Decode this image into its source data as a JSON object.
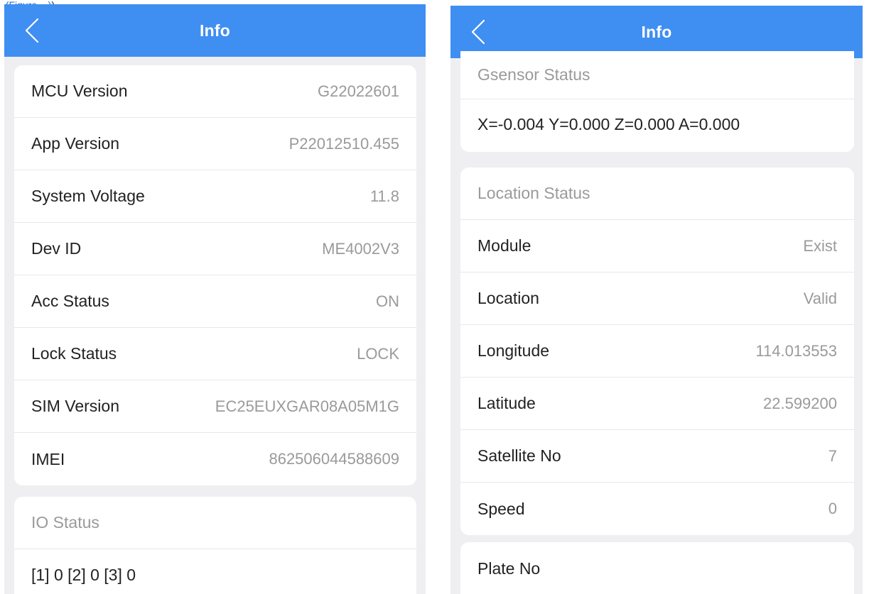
{
  "caption": {
    "prefix": ", ",
    "link": "(Figure ...)",
    "suffix": ")"
  },
  "left_screen": {
    "header": {
      "title": "Info",
      "back_icon": "chevron-left-icon"
    },
    "info_rows": [
      {
        "label": "MCU Version",
        "value": "G22022601"
      },
      {
        "label": "App Version",
        "value": "P22012510.455"
      },
      {
        "label": "System Voltage",
        "value": "11.8"
      },
      {
        "label": "Dev ID",
        "value": "ME4002V3"
      },
      {
        "label": "Acc Status",
        "value": "ON"
      },
      {
        "label": "Lock Status",
        "value": "LOCK"
      },
      {
        "label": "SIM Version",
        "value": "EC25EUXGAR08A05M1G"
      },
      {
        "label": "IMEI",
        "value": "862506044588609"
      }
    ],
    "io_status": {
      "section_title": "IO Status",
      "value": "[1] 0 [2] 0 [3] 0"
    }
  },
  "right_screen": {
    "header": {
      "title": "Info",
      "back_icon": "chevron-left-icon"
    },
    "gsensor": {
      "section_title": "Gsensor Status",
      "value": "X=-0.004 Y=0.000 Z=0.000 A=0.000"
    },
    "location": {
      "section_title": "Location Status",
      "rows": [
        {
          "label": "Module",
          "value": "Exist"
        },
        {
          "label": "Location",
          "value": "Valid"
        },
        {
          "label": "Longitude",
          "value": "114.013553"
        },
        {
          "label": "Latitude",
          "value": "22.599200"
        },
        {
          "label": "Satellite No",
          "value": "7"
        },
        {
          "label": "Speed",
          "value": "0"
        }
      ]
    },
    "plate": {
      "label": "Plate No"
    }
  },
  "colors": {
    "appbar": "#3f8ef2",
    "background": "#efeff1",
    "card": "#ffffff",
    "value_text": "#9a9a9a",
    "label_text": "#222222"
  }
}
